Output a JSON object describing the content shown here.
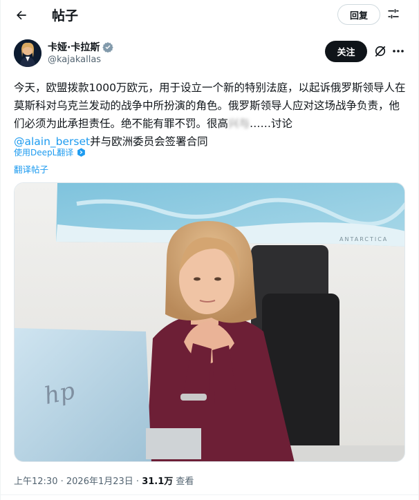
{
  "header": {
    "title": "帖子",
    "reply_label": "回复"
  },
  "author": {
    "name": "卡娅·卡拉斯",
    "handle": "@kajakallas",
    "follow_label": "关注"
  },
  "post": {
    "text_before_blur": "今天，欧盟拨款1000万欧元，用于设立一个新的特别法庭，以起诉俄罗斯领导人在莫斯科对乌克兰发动的战争中所扮演的角色。俄罗斯领导人应对这场战争负责，他们必须为此承担责任。绝不能有罪不罚。很高",
    "text_blurred": "兴与",
    "text_after_blur": "……讨论",
    "mention": "@alain_berset",
    "text_after_mention": "并与欧洲委员会签署合同",
    "translated_by": "使用DeepL翻译",
    "translate_link": "翻译帖子"
  },
  "photo": {
    "map_label": "ANTARCTICA"
  },
  "meta": {
    "time": "上午12:30",
    "date": "2026年1月23日",
    "views": "31.1万",
    "views_label": "查看"
  },
  "colors": {
    "accent": "#1d9bf0",
    "text": "#0f1419",
    "secondary": "#536471"
  }
}
